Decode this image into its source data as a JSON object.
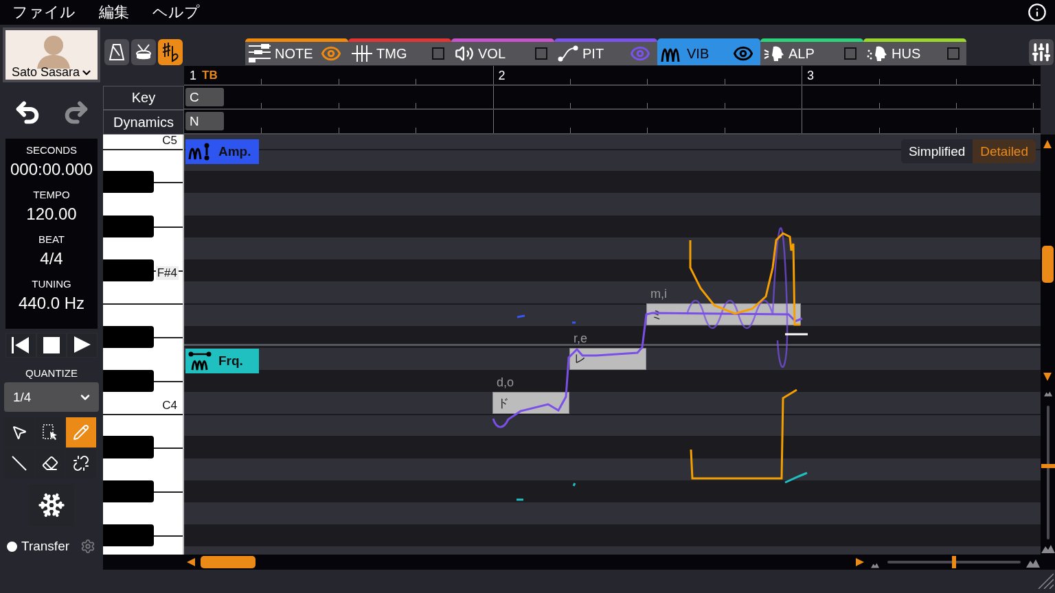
{
  "menu": [
    "ファイル",
    "編集",
    "ヘルプ"
  ],
  "singer": {
    "name": "Sato Sasara"
  },
  "undo": {
    "disabled": false
  },
  "redo": {
    "disabled": true
  },
  "info": [
    {
      "label": "SECONDS",
      "value": "000:00.000"
    },
    {
      "label": "TEMPO",
      "value": "120.00"
    },
    {
      "label": "BEAT",
      "value": "4/4"
    },
    {
      "label": "TUNING",
      "value": "440.0 Hz"
    }
  ],
  "quantize": {
    "label": "QUANTIZE",
    "value": "1/4"
  },
  "tools": [
    {
      "kind": "pointer",
      "selected": false
    },
    {
      "kind": "range",
      "selected": false
    },
    {
      "kind": "pencil",
      "selected": true
    },
    {
      "kind": "line",
      "selected": false
    },
    {
      "kind": "eraser",
      "selected": false
    },
    {
      "kind": "unlink",
      "selected": false
    }
  ],
  "transfer": {
    "label": "Transfer",
    "on": false
  },
  "modes": [
    {
      "kind": "metronome",
      "selected": false
    },
    {
      "kind": "drum",
      "selected": false
    },
    {
      "kind": "accidental",
      "selected": true
    }
  ],
  "tabs": [
    {
      "kind": "note",
      "label": "NOTE",
      "color": "#ef8a0f",
      "shown": true,
      "selected": false
    },
    {
      "kind": "timing",
      "label": "TMG",
      "color": "#e03535",
      "shown": false,
      "selected": false
    },
    {
      "kind": "volume",
      "label": "VOL",
      "color": "#c653c9",
      "shown": false,
      "selected": false
    },
    {
      "kind": "pitch",
      "label": "PIT",
      "color": "#7b52ec",
      "shown": true,
      "selected": false
    },
    {
      "kind": "vibrato",
      "label": "VIB",
      "color": "#2f8fe3",
      "shown": true,
      "selected": true
    },
    {
      "kind": "alpha",
      "label": "ALP",
      "color": "#2fd07c",
      "shown": false,
      "selected": false
    },
    {
      "kind": "husky",
      "label": "HUS",
      "color": "#9bd62f",
      "shown": false,
      "selected": false
    }
  ],
  "ruler": [
    {
      "number": "1",
      "marker": "TB"
    },
    {
      "number": "2"
    },
    {
      "number": "3"
    }
  ],
  "key": {
    "label": "Key",
    "value": "C"
  },
  "dynamics": {
    "label": "Dynamics",
    "value": "N"
  },
  "keyboard": {
    "labels": [
      {
        "name": "C5",
        "highlighted": false
      },
      {
        "name": "F#4",
        "highlighted": true
      },
      {
        "name": "C4",
        "highlighted": false
      }
    ]
  },
  "panels": [
    {
      "kind": "amplitude",
      "label": "Amp.",
      "color": "#2f55f0"
    },
    {
      "kind": "frequency",
      "label": "Frq.",
      "color": "#20c0c0"
    }
  ],
  "view_modes": [
    {
      "label": "Simplified",
      "selected": false
    },
    {
      "label": "Detailed",
      "selected": true
    }
  ],
  "notes": [
    {
      "phonemes": "d,o",
      "lyric": "ド"
    },
    {
      "phonemes": "r,e",
      "lyric": "レ"
    },
    {
      "phonemes": "m,i",
      "lyric": "ミ"
    }
  ],
  "h_zoom": {
    "level": 0.5
  },
  "v_zoom": {
    "level": 0.55
  }
}
